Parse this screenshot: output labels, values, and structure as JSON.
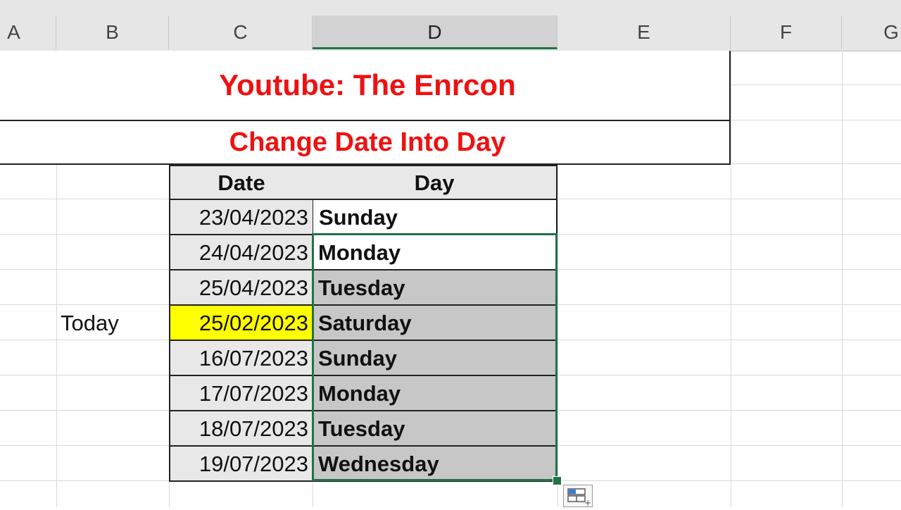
{
  "columns": [
    "A",
    "B",
    "C",
    "D",
    "E",
    "F",
    "G"
  ],
  "active_column": "D",
  "title": "Youtube: The Enrcon",
  "subtitle": "Change Date Into Day",
  "table": {
    "headers": [
      "Date",
      "Day"
    ],
    "rows": [
      {
        "date": "23/04/2023",
        "day": "Sunday"
      },
      {
        "date": "24/04/2023",
        "day": "Monday"
      },
      {
        "date": "25/04/2023",
        "day": "Tuesday"
      },
      {
        "date": "25/02/2023",
        "day": "Saturday"
      },
      {
        "date": "16/07/2023",
        "day": "Sunday"
      },
      {
        "date": "17/07/2023",
        "day": "Monday"
      },
      {
        "date": "18/07/2023",
        "day": "Tuesday"
      },
      {
        "date": "19/07/2023",
        "day": "Wednesday"
      }
    ]
  },
  "side_label": "Today",
  "colors": {
    "title": "#ee1111",
    "highlight": "#ffff00",
    "selection_border": "#217346",
    "selected_fill": "#c7c7c7"
  },
  "icons": {
    "quick_analysis": "quick-analysis-icon",
    "fill_handle": "fill-handle-icon"
  }
}
